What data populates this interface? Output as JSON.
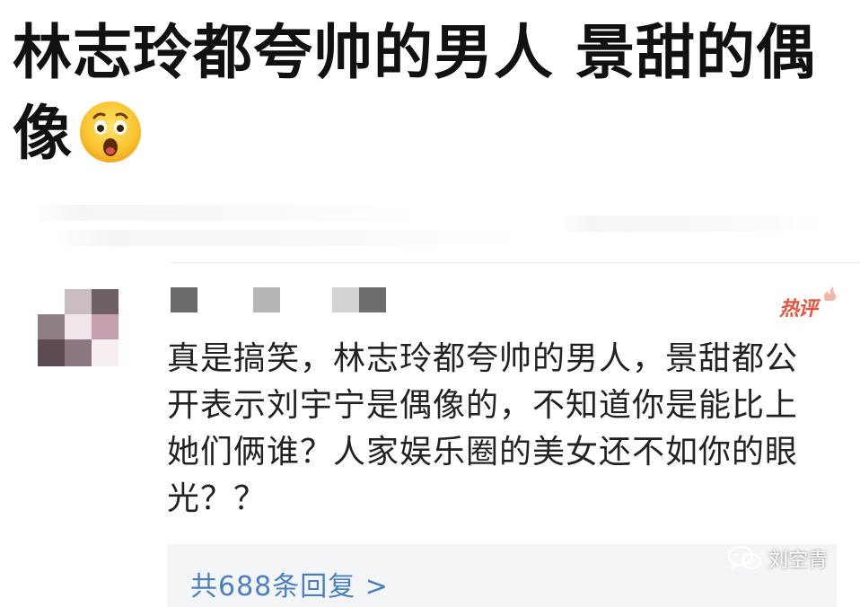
{
  "headline": {
    "text": "林志玲都夸帅的男人 景甜的偶像",
    "emoji": "astonished-face-emoji"
  },
  "comment": {
    "badge": "热评",
    "text": "真是搞笑，林志玲都夸帅的男人，景甜都公开表示刘宇宁是偶像的，不知道你是能比上她们俩谁？人家娱乐圈的美女还不如你的眼光？？",
    "avatar_icon": "pixelated-avatar",
    "username_icon": "pixelated-username"
  },
  "replies": {
    "link_text": "共688条回复 >"
  },
  "watermark": {
    "icon": "wechat-icon",
    "text": "刘空青"
  },
  "colors": {
    "headline": "#111111",
    "comment_text": "#222222",
    "hot_badge": "#e8553f",
    "reply_link": "#4a7fbf",
    "reply_box_bg": "#f4f5f7"
  }
}
